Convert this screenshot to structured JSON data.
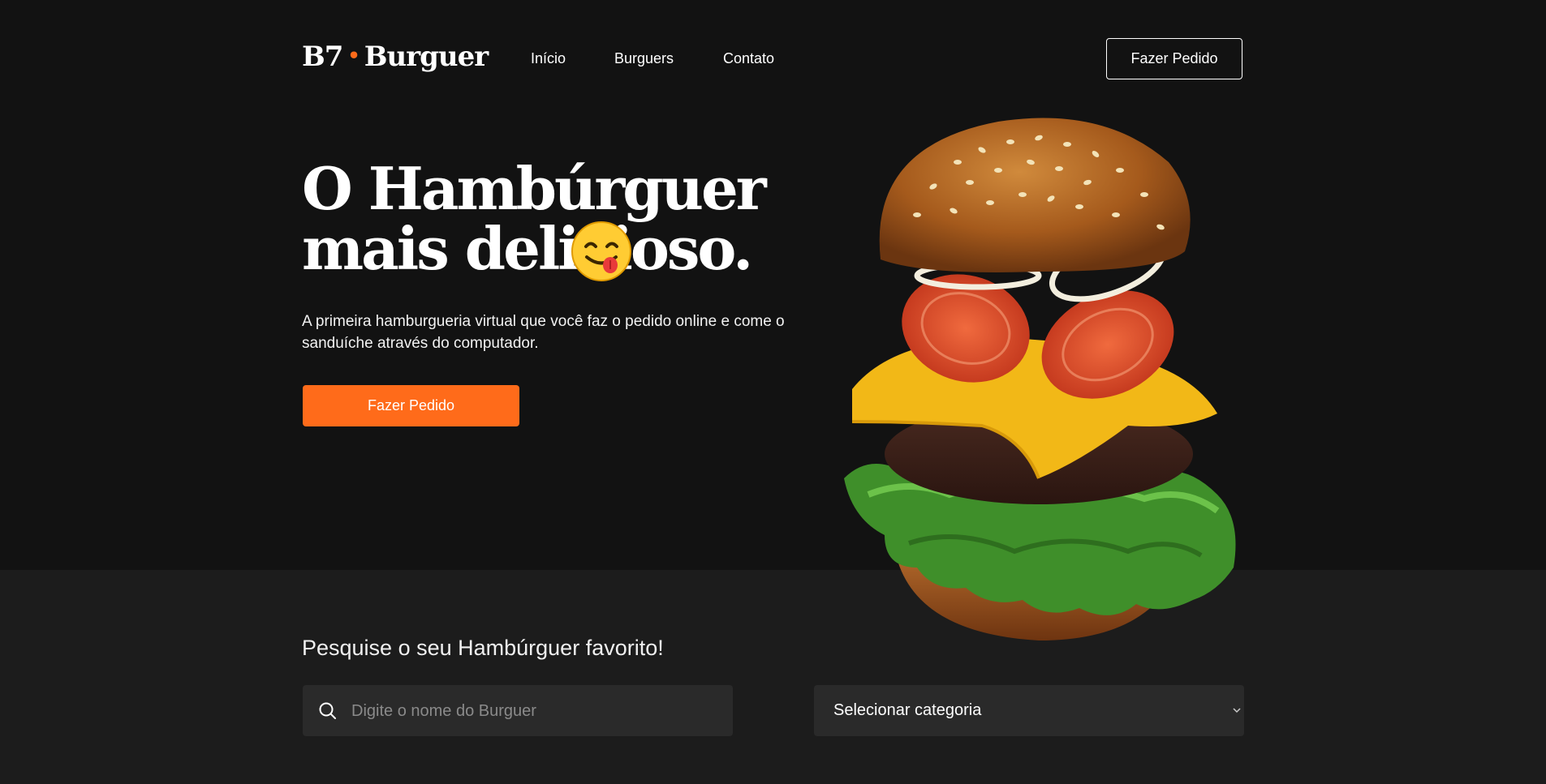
{
  "brand": {
    "part1": "B7",
    "separator": "•",
    "part2": "Burguer",
    "accent_color": "#ff6b1a"
  },
  "nav": {
    "items": [
      "Início",
      "Burguers",
      "Contato"
    ]
  },
  "header": {
    "order_button": "Fazer Pedido"
  },
  "hero": {
    "headline": "O Hambúrguer mais delicioso.",
    "headline_emoji": "yum-face-emoji",
    "subtitle": "A primeira hamburgueria virtual que você faz o pedido online e come o sanduíche através do computador.",
    "cta_button": "Fazer Pedido",
    "image": "floating-burger-image"
  },
  "search": {
    "title": "Pesquise o seu Hambúrguer favorito!",
    "input_placeholder": "Digite o nome do Burguer",
    "input_value": "",
    "category_selected": "Selecionar categoria",
    "search_icon": "search-icon",
    "select_icon": "chevron-down-icon"
  },
  "colors": {
    "hero_background": "#121212",
    "section_background": "#1c1c1c",
    "field_background": "#2a2a2a",
    "primary": "#ff6b1a"
  }
}
